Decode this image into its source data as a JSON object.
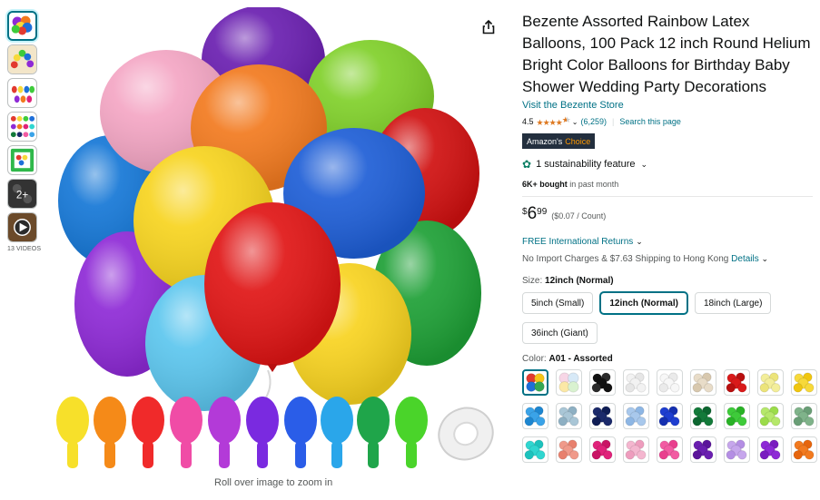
{
  "gallery": {
    "thumbs": [
      {
        "icon": "balloon-bunch-thumbnail",
        "active": true
      },
      {
        "icon": "balloon-arch-thumbnail"
      },
      {
        "icon": "balloon-sizes-thumbnail"
      },
      {
        "icon": "balloon-colors-thumbnail"
      },
      {
        "icon": "balloon-pack-thumbnail"
      },
      {
        "icon": "more-images-thumbnail",
        "overlay": "2+"
      },
      {
        "icon": "video-thumbnail"
      }
    ],
    "videos_label": "13 VIDEOS",
    "zoom_hint": "Roll over image to zoom in"
  },
  "product": {
    "title": "Bezente Assorted Rainbow Latex Balloons, 100 Pack 12 inch Round Helium Bright Color Balloons for Birthday Baby Shower Wedding Party Decorations",
    "store_link": "Visit the Bezente Store",
    "rating": "4.5",
    "rating_stars": 4.5,
    "rating_count": "(6,259)",
    "search_link": "Search this page",
    "badge_left": "Amazon's",
    "badge_right": "Choice",
    "sustainability": "1 sustainability feature",
    "bought_bold": "6K+ bought",
    "bought_rest": " in past month",
    "price_symbol": "$",
    "price_whole": "6",
    "price_fraction": "99",
    "price_unit": "($0.07 / Count)",
    "shipping_link": "FREE International Returns",
    "import_text": "No Import Charges & $7.63 Shipping to Hong Kong",
    "details_link": "Details"
  },
  "size": {
    "label": "Size:",
    "selected": "12inch (Normal)",
    "options": [
      "5inch (Small)",
      "12inch (Normal)",
      "18inch (Large)",
      "36inch (Giant)"
    ]
  },
  "color": {
    "label": "Color:",
    "selected": "A01 - Assorted",
    "swatches": [
      {
        "colors": [
          "#e23a2f",
          "#f5c518",
          "#1e6fd9",
          "#34a853"
        ],
        "selected": true
      },
      {
        "colors": [
          "#f7d6e6",
          "#d7e9f7",
          "#fbe8a6",
          "#d9f2d0"
        ]
      },
      {
        "colors": [
          "#111111",
          "#2a2a2a"
        ]
      },
      {
        "colors": [
          "#f2f2f2",
          "#e6e6e6"
        ]
      },
      {
        "colors": [
          "#f7f7f7",
          "#eaeaea"
        ]
      },
      {
        "colors": [
          "#e8dcc8",
          "#d8c8ae"
        ]
      },
      {
        "colors": [
          "#d91a1a",
          "#b80f0f"
        ]
      },
      {
        "colors": [
          "#f3ee9a",
          "#ece47a"
        ]
      },
      {
        "colors": [
          "#f7d93a",
          "#f0c60f"
        ]
      },
      {
        "colors": [
          "#3aa3e8",
          "#1d86d0"
        ]
      },
      {
        "colors": [
          "#a9c6d6",
          "#8eb0c3"
        ]
      },
      {
        "colors": [
          "#1b2a6b",
          "#0f1d55"
        ]
      },
      {
        "colors": [
          "#a8c8ec",
          "#8db6e4"
        ]
      },
      {
        "colors": [
          "#1e3ed0",
          "#1530b0"
        ]
      },
      {
        "colors": [
          "#137a3a",
          "#0c6630"
        ]
      },
      {
        "colors": [
          "#3ecb3a",
          "#28b226"
        ]
      },
      {
        "colors": [
          "#b5e86a",
          "#9bdc4a"
        ]
      },
      {
        "colors": [
          "#7fb38a",
          "#699e76"
        ]
      },
      {
        "colors": [
          "#2fd6d0",
          "#1cc2bd"
        ]
      },
      {
        "colors": [
          "#f09a8a",
          "#e8806d"
        ]
      },
      {
        "colors": [
          "#e0227a",
          "#c91465"
        ]
      },
      {
        "colors": [
          "#f4b6cf",
          "#ee9dbe"
        ]
      },
      {
        "colors": [
          "#f25ba2",
          "#e93f8e"
        ]
      },
      {
        "colors": [
          "#6a1fb0",
          "#5a159a"
        ]
      },
      {
        "colors": [
          "#c6a6ec",
          "#b48ee4"
        ]
      },
      {
        "colors": [
          "#8e2ad6",
          "#7a1cc0"
        ]
      },
      {
        "colors": [
          "#f27a1f",
          "#e6650d"
        ]
      }
    ]
  }
}
